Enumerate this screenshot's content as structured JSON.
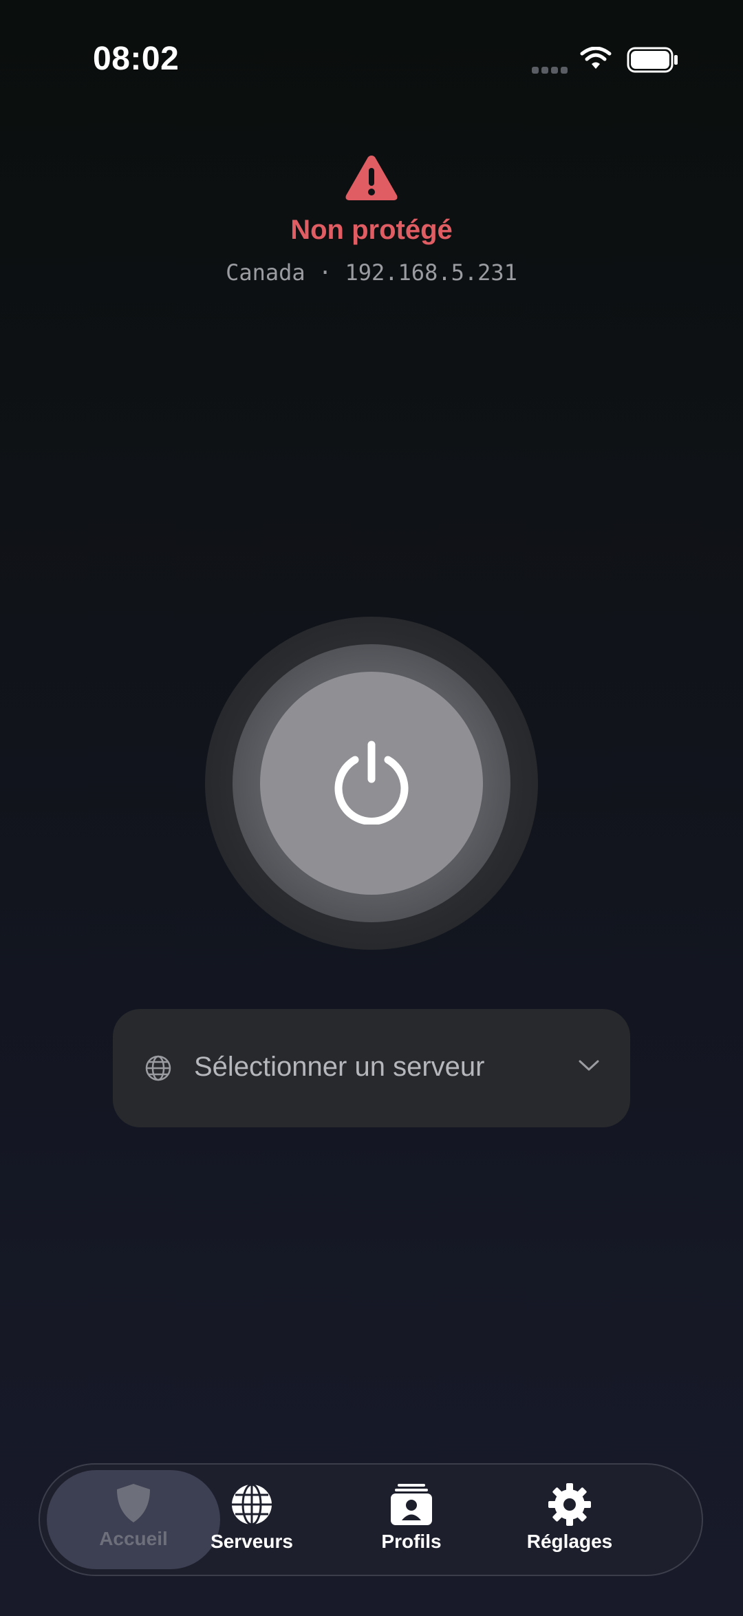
{
  "status_bar": {
    "time": "08:02"
  },
  "connection": {
    "status": "Non protégé",
    "details": "Canada · 192.168.5.231",
    "status_color": "#e15d64"
  },
  "power_button": {
    "icon": "power-icon"
  },
  "server_selector": {
    "placeholder": "Sélectionner un serveur",
    "icon": "globe-icon"
  },
  "tabbar": {
    "items": [
      {
        "label": "Accueil",
        "icon": "shield-icon",
        "active": true
      },
      {
        "label": "Serveurs",
        "icon": "globe-icon",
        "active": false
      },
      {
        "label": "Profils",
        "icon": "profile-card-icon",
        "active": false
      },
      {
        "label": "Réglages",
        "icon": "gear-icon",
        "active": false
      }
    ]
  }
}
